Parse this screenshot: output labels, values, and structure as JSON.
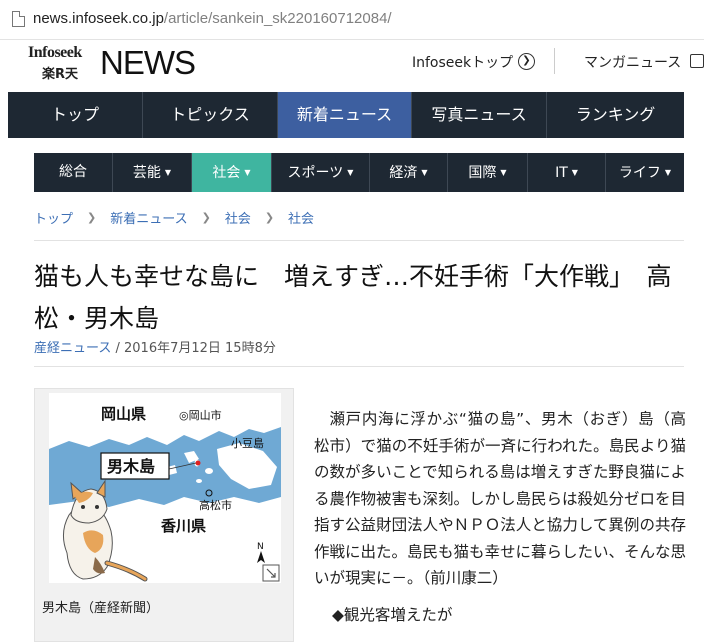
{
  "browser": {
    "url_host": "news.infoseek.co.jp",
    "url_path": "/article/sankein_sk220160712084/"
  },
  "header": {
    "logo_infoseek": "Infoseek",
    "logo_rakuten": "楽R天",
    "logo_news": "NEWS",
    "link_infoseek_top": "Infoseekトップ",
    "link_manga": "マンガニュース"
  },
  "nav_main": {
    "items": [
      {
        "label": "トップ"
      },
      {
        "label": "トピックス"
      },
      {
        "label": "新着ニュース"
      },
      {
        "label": "写真ニュース"
      },
      {
        "label": "ランキング"
      }
    ],
    "active_index": 2
  },
  "nav_sub": {
    "items": [
      {
        "label": "総合"
      },
      {
        "label": "芸能"
      },
      {
        "label": "社会"
      },
      {
        "label": "スポーツ"
      },
      {
        "label": "経済"
      },
      {
        "label": "国際"
      },
      {
        "label": "IT"
      },
      {
        "label": "ライフ"
      }
    ],
    "active_index": 2
  },
  "breadcrumb": {
    "items": [
      "トップ",
      "新着ニュース",
      "社会",
      "社会"
    ]
  },
  "article": {
    "title": "猫も人も幸せな島に　増えすぎ…不妊手術「大作戦」　高松・男木島",
    "source": "産経ニュース",
    "date": " / 2016年7月12日 15時8分",
    "body": "瀬戸内海に浮かぶ“猫の島”、男木（おぎ）島（高松市）で猫の不妊手術が一斉に行われた。島民より猫の数が多いことで知られる島は増えすぎた野良猫による農作物被害も深刻。しかし島民らは殺処分ゼロを目指す公益財団法人やＮＰＯ法人と協力して異例の共存作戦に出た。島民も猫も幸せに暮らしたい、そんな思いが現実に－。（前川康二）",
    "subhead": "◆観光客増えたが"
  },
  "figure": {
    "map_labels": {
      "okayama_pref": "岡山県",
      "okayama_city": "◎岡山市",
      "shodoshima": "小豆島",
      "ogijima": "男木島",
      "takamatsu": "高松市",
      "kagawa_pref": "香川県",
      "north": "N"
    },
    "caption": "男木島（産経新聞）"
  },
  "colors": {
    "nav_bg": "#1e2833",
    "nav_active": "#3d5fa0",
    "subnav_active": "#3fb5a0",
    "link": "#3d6fb5",
    "sea": "#6fa9d4",
    "land": "#ffffff"
  }
}
